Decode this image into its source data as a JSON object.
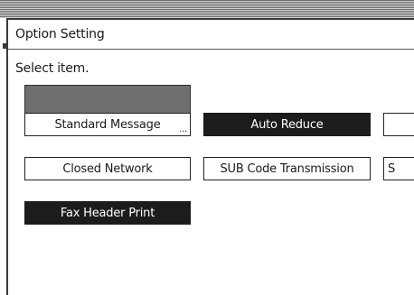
{
  "screen": {
    "title": "Option Setting",
    "instruction": "Select item."
  },
  "options": {
    "standard_message": {
      "label": "Standard Message",
      "more_indicator": "...",
      "selected": false
    },
    "auto_reduce": {
      "label": "Auto Reduce",
      "selected": true
    },
    "closed_network": {
      "label": "Closed Network",
      "selected": false
    },
    "sub_code_transmission": {
      "label": "SUB Code Transmission",
      "selected": false
    },
    "third_column_row2_partial": {
      "label": "S",
      "selected": false
    },
    "fax_header_print": {
      "label": "Fax Header Print",
      "selected": true
    }
  },
  "colors": {
    "selected_fill": "#1c1c1c",
    "label_box_fill": "#6f6f6f",
    "border": "#222222",
    "background": "#ffffff"
  }
}
